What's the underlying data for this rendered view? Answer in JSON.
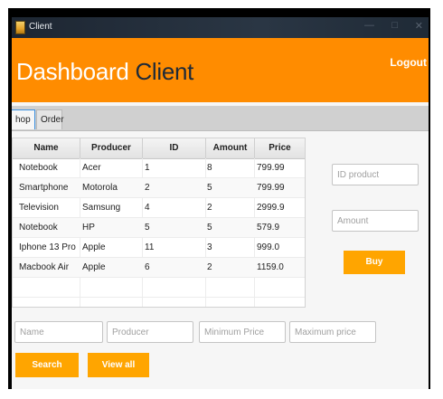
{
  "window": {
    "title": "Client"
  },
  "header": {
    "title_part1": "Dashboard",
    "title_part2": "Client",
    "logout_label": "Logout"
  },
  "tabs": [
    {
      "label": "hop",
      "selected": true
    },
    {
      "label": "Order",
      "selected": false
    }
  ],
  "table": {
    "columns": [
      "Name",
      "Producer",
      "ID",
      "Amount",
      "Price"
    ],
    "rows": [
      [
        "Notebook",
        "Acer",
        "1",
        "8",
        "799.99"
      ],
      [
        "Smartphone",
        "Motorola",
        "2",
        "5",
        "799.99"
      ],
      [
        "Television",
        "Samsung",
        "4",
        "2",
        "2999.9"
      ],
      [
        "Notebook",
        "HP",
        "5",
        "5",
        "579.9"
      ],
      [
        "Iphone 13 Pro",
        "Apple",
        "11",
        "3",
        "999.0"
      ],
      [
        "Macbook Air",
        "Apple",
        "6",
        "2",
        "1159.0"
      ]
    ]
  },
  "side_form": {
    "id_product_placeholder": "ID product",
    "amount_placeholder": "Amount",
    "buy_label": "Buy"
  },
  "filters": {
    "name_placeholder": "Name",
    "producer_placeholder": "Producer",
    "min_price_placeholder": "Minimum Price",
    "max_price_placeholder": "Maximum price",
    "search_label": "Search",
    "view_all_label": "View all"
  },
  "colors": {
    "accent": "#ff8c00",
    "button": "#ffa500",
    "title_dark": "#1e2a38"
  }
}
